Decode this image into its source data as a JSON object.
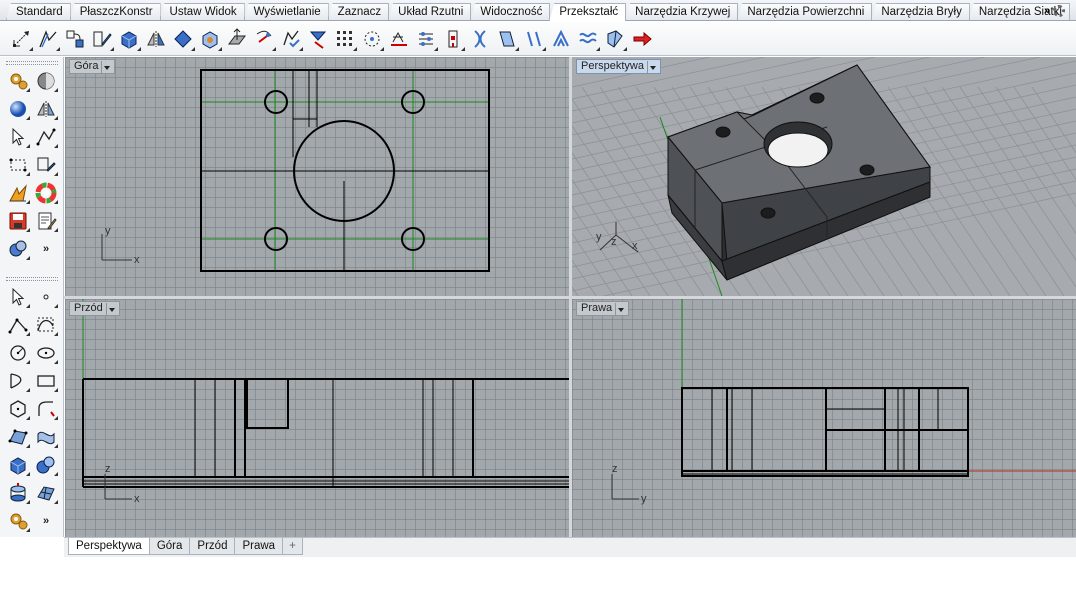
{
  "tabs": [
    "Standard",
    "PłaszczKonstr",
    "Ustaw Widok",
    "Wyświetlanie",
    "Zaznacz",
    "Układ Rzutni",
    "Widoczność",
    "Przekształć",
    "Narzędzia Krzywej",
    "Narzędzia Powierzchni",
    "Narzędzia Bryły",
    "Narzędzia Siatki"
  ],
  "active_tab": "Przekształć",
  "more_label": "»",
  "toolbar_icons": [
    "move-icon",
    "copy-icon",
    "rotate-icon",
    "scale-icon",
    "mirror-icon",
    "orient-icon",
    "array-icon",
    "transform-icon",
    "align-icon",
    "polar-array-icon",
    "grid-array-icon",
    "array-curve-icon",
    "snap-icon",
    "twist-icon",
    "bend-icon",
    "taper-icon",
    "flow-icon",
    "stretch-icon",
    "shear-icon",
    "smooth-icon",
    "cage-icon",
    "splop-icon",
    "camera-icon",
    "arrow-icon"
  ],
  "viewports": {
    "top": {
      "label": "Góra",
      "axis_x": "x",
      "axis_y": "y"
    },
    "perspective": {
      "label": "Perspektywa",
      "axis_x": "x",
      "axis_y": "y",
      "axis_z": "z"
    },
    "front": {
      "label": "Przód",
      "axis_x": "x",
      "axis_z": "z"
    },
    "right": {
      "label": "Prawa",
      "axis_y": "y",
      "axis_z": "z"
    }
  },
  "bottom_tabs": [
    "Perspektywa",
    "Góra",
    "Przód",
    "Prawa"
  ],
  "bottom_active": "Perspektywa",
  "bottom_add": "+",
  "left_more": "»",
  "colors": {
    "grid_bg": "#a3a8ad",
    "green_axis": "#1a8a1a",
    "red_axis": "#b03020",
    "highlight_label": "#c9d8ea"
  }
}
